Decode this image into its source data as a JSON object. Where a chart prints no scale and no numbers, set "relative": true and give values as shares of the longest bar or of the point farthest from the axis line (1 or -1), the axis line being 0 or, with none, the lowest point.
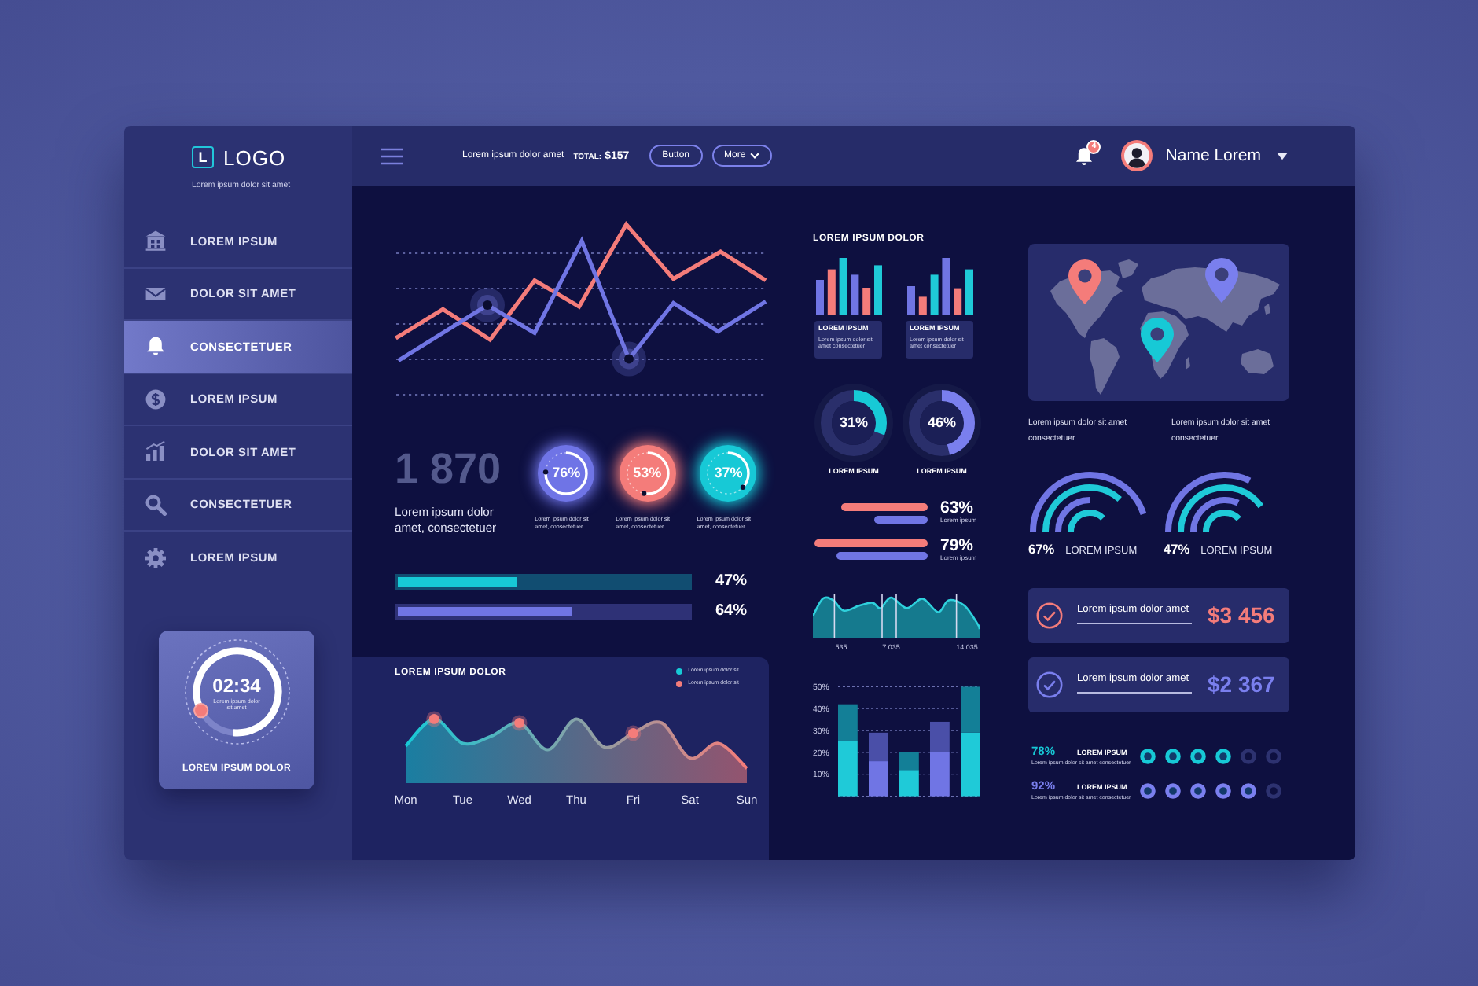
{
  "sidebar": {
    "logo": {
      "mark": "L",
      "text": "LOGO"
    },
    "tagline": "Lorem ipsum dolor sit amet",
    "items": [
      {
        "label": "LOREM IPSUM",
        "selected": false
      },
      {
        "label": "DOLOR SIT AMET",
        "selected": false
      },
      {
        "label": "CONSECTETUER",
        "selected": true
      },
      {
        "label": "LOREM IPSUM",
        "selected": false
      },
      {
        "label": "DOLOR SIT AMET",
        "selected": false
      },
      {
        "label": "CONSECTETUER",
        "selected": false
      },
      {
        "label": "LOREM IPSUM",
        "selected": false
      }
    ],
    "timer": {
      "time": "02:34",
      "caption": "Lorem ipsum dolor sit amet",
      "label": "LOREM IPSUM DOLOR",
      "level": 0.84
    }
  },
  "top_bar": {
    "text": "Lorem ipsum dolor amet",
    "total_label": "TOTAL:",
    "total_value": "$157",
    "buttons": [
      {
        "label": "Button",
        "kind": "plain"
      },
      {
        "label": "More",
        "kind": "dropdown"
      }
    ],
    "notification_count": "4",
    "user_name": "Name Lorem"
  },
  "stats": {
    "number": "1 870",
    "caption": "Lorem ipsum dolor amet, consectetuer",
    "rings": [
      {
        "value": "76%",
        "caption": "Lorem ipsum dolor sit amet, consectetuer",
        "level": 0.76,
        "color": "#6f74e6"
      },
      {
        "value": "53%",
        "caption": "Lorem ipsum dolor sit amet, consectetuer",
        "level": 0.53,
        "color": "#f47c7a"
      },
      {
        "value": "37%",
        "caption": "Lorem ipsum dolor sit amet, consectetuer",
        "level": 0.37,
        "color": "#17c9d6"
      }
    ]
  },
  "progress": [
    {
      "reading": "47%",
      "level": 0.41,
      "color": "#17c9d6"
    },
    {
      "reading": "64%",
      "level": 0.6,
      "color": "#7075e4"
    }
  ],
  "area_chart": {
    "title": "LOREM IPSUM DOLOR",
    "legend": [
      {
        "label": "Lorem ipsum dolor sit",
        "color": "#17c9d6"
      },
      {
        "label": "Lorem ipsum dolor sit",
        "color": "#f47c7a"
      }
    ],
    "chart_data": {
      "type": "area",
      "relative": true,
      "categories": [
        "Mon",
        null,
        "Tue",
        null,
        "Wed",
        null,
        "Thu",
        null,
        "Fri",
        null,
        "Sat",
        null,
        "Sun"
      ],
      "series": [
        {
          "values": [
            0.58,
            1,
            0.62,
            0.73,
            0.94,
            0.52,
            1,
            0.56,
            0.78,
            0.94,
            0.39,
            0.62,
            0.23
          ]
        }
      ]
    }
  },
  "mini_charts": {
    "title": "LOREM IPSUM DOLOR",
    "cards": [
      {
        "heading": "LOREM IPSUM",
        "text": "Lorem ipsum dolor sit amet consectetuer"
      },
      {
        "heading": "LOREM IPSUM",
        "text": "Lorem ipsum dolor sit amet consectetuer"
      }
    ]
  },
  "donuts": [
    {
      "value": "31%",
      "label": "LOREM IPSUM",
      "level": 0.31,
      "color": "#17c9d6"
    },
    {
      "value": "46%",
      "label": "LOREM IPSUM",
      "level": 0.46,
      "color": "#7a7fee"
    }
  ],
  "bar_stats": [
    {
      "value": "63%",
      "caption": "Lorem ipsum"
    },
    {
      "value": "79%",
      "caption": "Lorem ipsum"
    }
  ],
  "wave": {
    "labels": [
      "535",
      "7 035",
      "14 035"
    ]
  },
  "bar_chart": {
    "chart_data": {
      "type": "bar",
      "stacked": true,
      "grid": true,
      "ylim": [
        0,
        50
      ],
      "yticks": [
        {
          "value": 10,
          "label": "10%"
        },
        {
          "value": 20,
          "label": "20%"
        },
        {
          "value": 30,
          "label": "30%"
        },
        {
          "value": 40,
          "label": "40%"
        },
        {
          "value": 50,
          "label": "50%"
        }
      ],
      "series": [
        {
          "color": "#1fcad8",
          "values": [
            25,
            null,
            12,
            null,
            29
          ]
        },
        {
          "color": "#137f97",
          "values": [
            17,
            null,
            8,
            null,
            21
          ]
        },
        {
          "color": "#7075e4",
          "values": [
            null,
            16,
            null,
            20,
            null
          ]
        },
        {
          "color": "#4a4fa8",
          "values": [
            null,
            13,
            null,
            14,
            null
          ]
        }
      ]
    }
  },
  "map": {
    "pins": [
      {
        "color": "#f47c7a"
      },
      {
        "color": "#7a7fee"
      },
      {
        "color": "#17c9d6"
      }
    ],
    "notes": [
      "Lorem ipsum dolor sit amet consectetuer",
      "Lorem ipsum dolor sit amet consectetuer"
    ]
  },
  "gauges": [
    {
      "value": "67%",
      "label": "LOREM IPSUM"
    },
    {
      "value": "47%",
      "label": "LOREM IPSUM"
    }
  ],
  "amounts": [
    {
      "label": "Lorem ipsum dolor amet",
      "amount": "$3 456",
      "color": "#f47c7a"
    },
    {
      "label": "Lorem ipsum dolor amet",
      "amount": "$2 367",
      "color": "#7a7fee"
    }
  ],
  "ratings": [
    {
      "value": "78%",
      "heading": "LOREM IPSUM",
      "text": "Lorem ipsum dolor sit amet consectetuer",
      "stars": 4,
      "color": "#17c9d6"
    },
    {
      "value": "92%",
      "heading": "LOREM IPSUM",
      "text": "Lorem ipsum dolor sit amet consectetuer",
      "stars": 5,
      "color": "#7a7fee"
    }
  ]
}
